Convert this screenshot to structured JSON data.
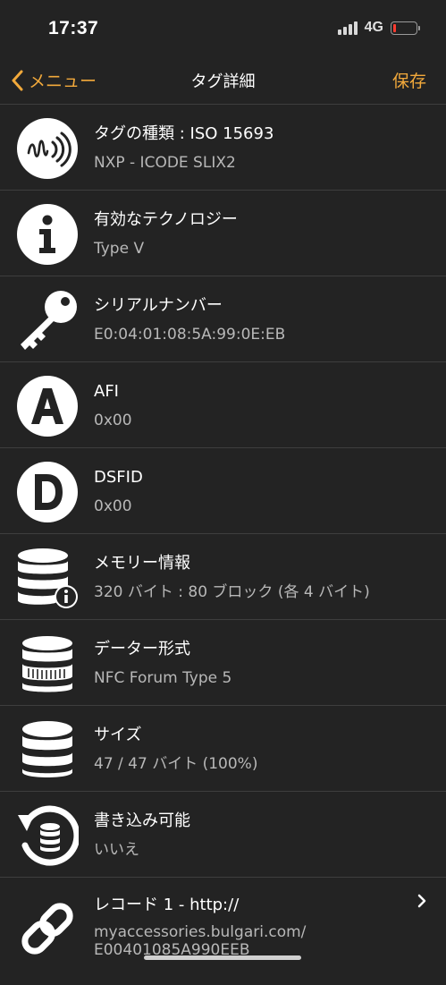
{
  "status": {
    "time": "17:37",
    "network": "4G",
    "battery_level": 0.12
  },
  "nav": {
    "back_label": "メニュー",
    "title": "タグ詳細",
    "save_label": "保存"
  },
  "rows": [
    {
      "icon": "nfc-sound-icon",
      "title": "タグの種類 : ISO 15693",
      "value": "NXP - ICODE SLIX2"
    },
    {
      "icon": "info-icon",
      "title": "有効なテクノロジー",
      "value": "Type V"
    },
    {
      "icon": "key-icon",
      "title": "シリアルナンバー",
      "value": "E0:04:01:08:5A:99:0E:EB"
    },
    {
      "icon": "letter-a-icon",
      "title": "AFI",
      "value": "0x00"
    },
    {
      "icon": "letter-d-icon",
      "title": "DSFID",
      "value": "0x00"
    },
    {
      "icon": "database-info-icon",
      "title": "メモリー情報",
      "value": "320 バイト : 80 ブロック (各 4 バイト)"
    },
    {
      "icon": "database-format-icon",
      "title": "データー形式",
      "value": "NFC Forum Type 5"
    },
    {
      "icon": "database-icon",
      "title": "サイズ",
      "value": "47 / 47 バイト (100%)"
    },
    {
      "icon": "database-refresh-icon",
      "title": "書き込み可能",
      "value": "いいえ"
    },
    {
      "icon": "link-icon",
      "title": "レコード 1 - http://",
      "value": "myaccessories.bulgari.com/\nE00401085A990EEB"
    }
  ],
  "colors": {
    "accent": "#f2a93b",
    "background": "#232323",
    "separator": "#3e3e3e",
    "secondary_text": "#b8b8b8"
  }
}
